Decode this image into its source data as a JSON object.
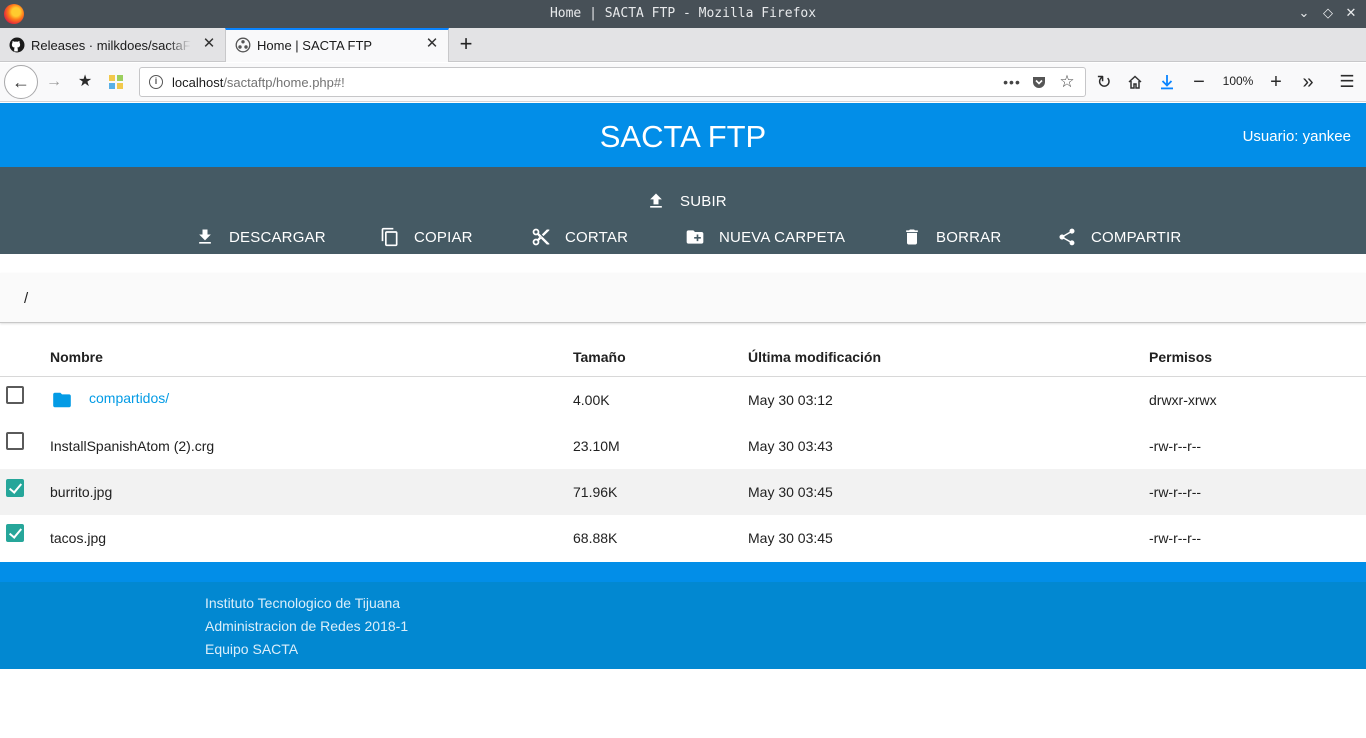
{
  "window": {
    "title": "Home | SACTA FTP - Mozilla Firefox"
  },
  "tabs": [
    {
      "label": "Releases · milkdoes/sactaFTP"
    },
    {
      "label": "Home | SACTA FTP"
    }
  ],
  "navbar": {
    "url_host": "localhost",
    "url_path": "/sactaftp/home.php#!",
    "zoom": "100%"
  },
  "app": {
    "title": "SACTA FTP",
    "user": "Usuario: yankee"
  },
  "actions": {
    "upload": "SUBIR",
    "download": "DESCARGAR",
    "copy": "COPIAR",
    "cut": "CORTAR",
    "new_folder": "NUEVA CARPETA",
    "delete": "BORRAR",
    "share": "COMPARTIR"
  },
  "breadcrumb": {
    "path": "/"
  },
  "table": {
    "headers": {
      "name": "Nombre",
      "size": "Tamaño",
      "modified": "Última modificación",
      "perms": "Permisos"
    },
    "rows": [
      {
        "name": "compartidos/",
        "size": "4.00K",
        "modified": "May 30 03:12",
        "perms": "drwxr-xrwx",
        "checked": false,
        "is_folder": true
      },
      {
        "name": "InstallSpanishAtom (2).crg",
        "size": "23.10M",
        "modified": "May 30 03:43",
        "perms": "-rw-r--r--",
        "checked": false,
        "is_folder": false
      },
      {
        "name": "burrito.jpg",
        "size": "71.96K",
        "modified": "May 30 03:45",
        "perms": "-rw-r--r--",
        "checked": true,
        "is_folder": false
      },
      {
        "name": "tacos.jpg",
        "size": "68.88K",
        "modified": "May 30 03:45",
        "perms": "-rw-r--r--",
        "checked": true,
        "is_folder": false
      }
    ]
  },
  "footer": {
    "line1": "Instituto Tecnologico de Tijuana",
    "line2": "Administracion de Redes 2018-1",
    "line3": "Equipo SACTA"
  },
  "colors": {
    "header_blue": "#028ee8",
    "toolbar_slate": "#455a64",
    "checkbox_teal": "#26a69a",
    "link_blue": "#039be5",
    "footer_blue": "#0288d1"
  }
}
